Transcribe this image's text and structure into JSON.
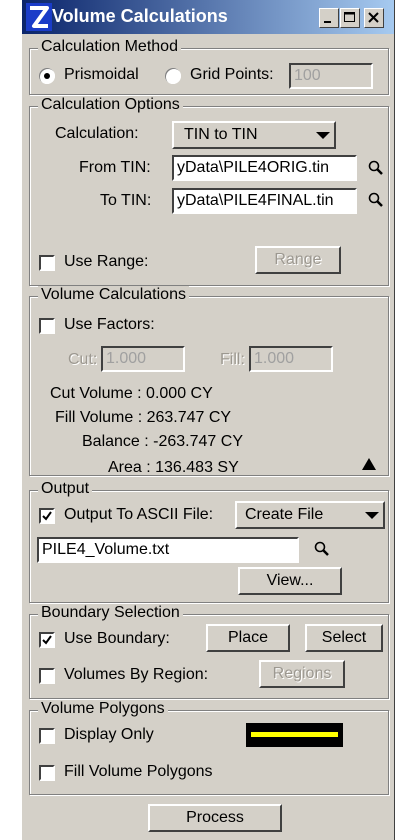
{
  "window": {
    "title": "Volume Calculations",
    "min": "_",
    "max": "□",
    "close": "x"
  },
  "calc_method": {
    "legend": "Calculation Method",
    "prismoidal": "Prismoidal",
    "grid_points": "Grid Points:",
    "grid_value": "100",
    "selected": "prismoidal"
  },
  "calc_options": {
    "legend": "Calculation Options",
    "calculation_label": "Calculation:",
    "calculation_value": "TIN to TIN",
    "from_tin_label": "From TIN:",
    "from_tin_value": "yData\\PILE4ORIG.tin",
    "to_tin_label": "To TIN:",
    "to_tin_value": "yData\\PILE4FINAL.tin",
    "use_range_label": "Use Range:",
    "use_range_checked": false,
    "range_button": "Range"
  },
  "volume_calcs": {
    "legend": "Volume Calculations",
    "use_factors_label": "Use Factors:",
    "use_factors_checked": false,
    "cut_label": "Cut:",
    "cut_value": "1.000",
    "fill_label": "Fill:",
    "fill_value": "1.000",
    "cut_volume": "Cut Volume : 0.000 CY",
    "fill_volume": "Fill Volume : 263.747 CY",
    "balance": "Balance : -263.747 CY",
    "area": "Area : 136.483 SY"
  },
  "output": {
    "legend": "Output",
    "ascii_label": "Output To ASCII File:",
    "ascii_checked": true,
    "mode_value": "Create File",
    "file_value": "PILE4_Volume.txt",
    "view_button": "View..."
  },
  "boundary": {
    "legend": "Boundary Selection",
    "use_boundary_label": "Use Boundary:",
    "use_boundary_checked": true,
    "place_button": "Place",
    "select_button": "Select",
    "by_region_label": "Volumes By Region:",
    "by_region_checked": false,
    "regions_button": "Regions"
  },
  "polygons": {
    "legend": "Volume Polygons",
    "display_only_label": "Display Only",
    "display_only_checked": false,
    "fill_label": "Fill Volume Polygons",
    "fill_checked": false,
    "symbology_color": "#ffff00"
  },
  "process_button": "Process"
}
